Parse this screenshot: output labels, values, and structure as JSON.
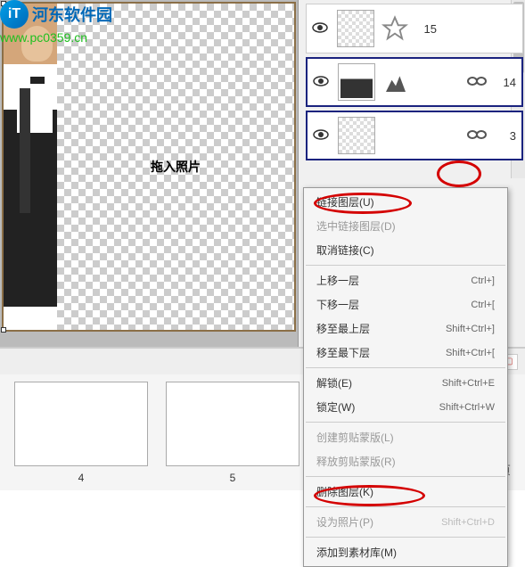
{
  "watermark": {
    "site_name": "河东软件园",
    "url": "www.pc0359.cn"
  },
  "canvas": {
    "drag_placeholder": "拖入照片"
  },
  "layers": {
    "items": [
      {
        "num": "15",
        "linked": false,
        "has_photo": false,
        "icon": "star"
      },
      {
        "num": "14",
        "linked": true,
        "has_photo": true,
        "icon": "mask"
      },
      {
        "num": "3",
        "linked": true,
        "has_photo": false,
        "icon": "none"
      }
    ]
  },
  "context_menu": {
    "link_layer": "链接图层(U)",
    "select_linked": "选中链接图层(D)",
    "cancel_link": "取消链接(C)",
    "move_up": "上移一层",
    "move_down": "下移一层",
    "move_top": "移至最上层",
    "move_bottom": "移至最下层",
    "unlock": "解锁(E)",
    "lock": "锁定(W)",
    "create_mask": "创建剪贴蒙版(L)",
    "release_mask": "释放剪贴蒙版(R)",
    "delete_layer": "删除图层(K)",
    "set_photo": "设为照片(P)",
    "add_to_lib": "添加到素材库(M)",
    "sc_up": "Ctrl+]",
    "sc_down": "Ctrl+[",
    "sc_top": "Shift+Ctrl+]",
    "sc_bottom": "Shift+Ctrl+[",
    "sc_unlock": "Shift+Ctrl+E",
    "sc_lock": "Shift+Ctrl+W",
    "sc_setphoto": "Shift+Ctrl+D"
  },
  "pages": {
    "items": [
      {
        "num": "4"
      },
      {
        "num": "5"
      }
    ],
    "label": "页"
  }
}
